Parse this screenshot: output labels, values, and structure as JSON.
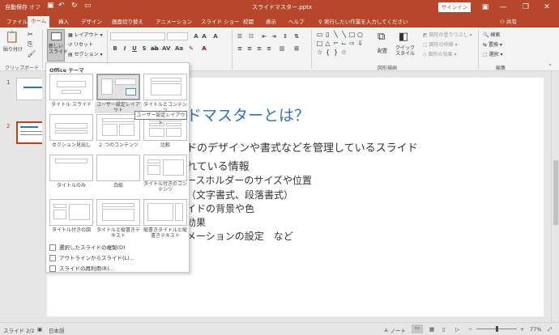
{
  "titlebar": {
    "autosave": "自動保存",
    "autosave_state": "オフ",
    "title": "スライドマスター.pptx",
    "signin": "サインイン"
  },
  "tabs": [
    "ファイル",
    "ホーム",
    "挿入",
    "デザイン",
    "画面切り替え",
    "アニメーション",
    "スライド ショー",
    "校閲",
    "表示",
    "ヘルプ"
  ],
  "tellme": "実行したい作業を入力してください",
  "share": "共有",
  "ribbon": {
    "paste": "貼り付け",
    "clipboard": "クリップボード",
    "new_slide": "新しい\nスライド",
    "layout": "レイアウト",
    "reset": "リセット",
    "section": "セクション",
    "drawing": "図形描画",
    "edit": "編集",
    "arrange": "配置",
    "quick_style": "クイック\nスタイル",
    "fill": "図形の塗りつぶし",
    "outline": "図形の枠線",
    "effect": "図形の効果",
    "find": "検索",
    "replace": "置換",
    "select": "選択"
  },
  "menu": {
    "header": "Office テーマ",
    "layouts": [
      {
        "label": "タイトル スライド"
      },
      {
        "label": "ユーザー設定レイアウト"
      },
      {
        "label": "タイトルとコンテンツ"
      },
      {
        "label": "セクション見出し"
      },
      {
        "label": "２ つのコンテンツ"
      },
      {
        "label": "比較"
      },
      {
        "label": "タイトルのみ"
      },
      {
        "label": "白紙"
      },
      {
        "label": "タイトル付きのコンテンツ"
      },
      {
        "label": "タイトル付きの図"
      },
      {
        "label": "タイトルと縦書きテキスト"
      },
      {
        "label": "縦書きタイトルと縦書きテキスト"
      }
    ],
    "items": [
      "選択したスライドの複製(D)",
      "アウトラインからスライド(L)...",
      "スライドの再利用(R)..."
    ]
  },
  "tooltip": "ユーザー設定レイアウト",
  "slide": {
    "title": "ドマスターとは？",
    "lines": [
      "ドのデザインや書式などを管理しているスライド",
      "れている情報",
      "ースホルダーのサイズや位置",
      "（文字書式、段落書式）",
      "イドの背景や色",
      "効果",
      "メーションの設定　など"
    ]
  },
  "thumbs": [
    "1",
    "2"
  ],
  "status": {
    "slide": "スライド 2/2",
    "lang": "日本語",
    "notes": "ノート",
    "zoom": "77%"
  }
}
